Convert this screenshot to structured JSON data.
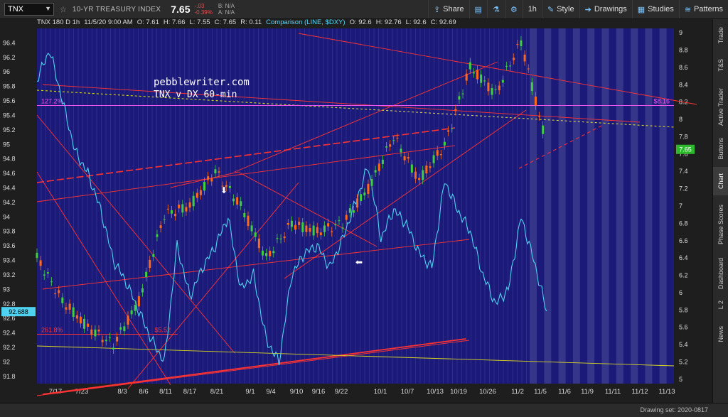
{
  "toolbar": {
    "symbol": "TNX",
    "index_name": "10-YR TREASURY INDEX",
    "last": "7.65",
    "change": "-.03",
    "change_pct": "-0.39%",
    "bid": "B: N/A",
    "ask": "A: N/A",
    "share_label": "Share",
    "interval_label": "1h",
    "style_label": "Style",
    "drawings_label": "Drawings",
    "studies_label": "Studies",
    "patterns_label": "Patterns"
  },
  "legend": {
    "main": "TNX 180 D 1h",
    "datetime": "11/5/20 9:00 AM",
    "o": "O: 7.61",
    "h": "H: 7.66",
    "l": "L: 7.55",
    "c": "C: 7.65",
    "r": "R: 0.11",
    "comparison": "Comparison (LINE, $DXY)",
    "co": "O: 92.6",
    "ch": "H: 92.76",
    "cl": "L: 92.6",
    "cc": "C: 92.69"
  },
  "right_panel": [
    "Trade",
    "T&S",
    "Active Trader",
    "Buttons",
    "Chart",
    "Phase Scores",
    "Dashboard",
    "L 2",
    "News"
  ],
  "bottom": {
    "drawing_set": "Drawing set: 2020-0817"
  },
  "colors": {
    "bg": "#1c1a78",
    "grid": "#5a5ac8",
    "future_band": "#35358a",
    "dxy": "#4fd2f0",
    "up": "#3fcf3f",
    "down": "#ff6a1a",
    "trend": "#ff3333",
    "fib": "#ee55ee",
    "yellow": "#d8d820"
  },
  "chart_data": {
    "type": "line",
    "annotations": [
      "pebblewriter.com",
      "TNX v DX 60-min"
    ],
    "left_axis_ticks": [
      96.4,
      96.2,
      96,
      95.8,
      95.6,
      95.4,
      95.2,
      95,
      94.8,
      94.6,
      94.4,
      94.2,
      94,
      93.8,
      93.6,
      93.4,
      93.2,
      93,
      92.8,
      92.6,
      92.4,
      92.2,
      92,
      91.8
    ],
    "right_axis_ticks": [
      9,
      8.8,
      8.6,
      8.4,
      8.2,
      8,
      7.8,
      7.6,
      7.4,
      7.2,
      7,
      6.8,
      6.6,
      6.4,
      6.2,
      6,
      5.8,
      5.6,
      5.4,
      5.2,
      5
    ],
    "x_ticks": [
      "7/17",
      "7/23",
      "8/3",
      "8/6",
      "8/11",
      "8/17",
      "8/21",
      "9/1",
      "9/4",
      "9/10",
      "9/16",
      "9/22",
      "10/1",
      "10/7",
      "10/13",
      "10/19",
      "10/26",
      "11/2",
      "11/5",
      "11/6",
      "11/9",
      "11/11",
      "11/12",
      "11/13"
    ],
    "left_ylim": [
      91.7,
      96.6
    ],
    "right_ylim": [
      4.95,
      9.05
    ],
    "left_price_tag": "92.688",
    "right_price_tag": "7.65",
    "fib_labels": [
      "127.2%",
      "$8.16",
      "261.8%",
      "$5.52"
    ],
    "fib_levels": [
      8.16,
      5.52
    ],
    "series": [
      {
        "name": "$DXY",
        "axis": "left",
        "x": [
          0,
          0.02,
          0.04,
          0.06,
          0.08,
          0.1,
          0.12,
          0.14,
          0.16,
          0.18,
          0.2,
          0.22,
          0.24,
          0.26,
          0.28,
          0.3,
          0.32,
          0.34,
          0.36,
          0.38,
          0.4,
          0.42,
          0.44,
          0.46,
          0.48,
          0.5,
          0.52,
          0.54,
          0.56,
          0.58,
          0.6,
          0.62,
          0.64,
          0.66,
          0.68,
          0.7,
          0.72,
          0.74,
          0.76,
          0.78,
          0.8
        ],
        "y": [
          95.9,
          96.3,
          95.6,
          94.9,
          94.6,
          94.1,
          93.4,
          93.1,
          92.7,
          92.3,
          92.0,
          93.6,
          92.9,
          93.3,
          93.6,
          94.0,
          93.0,
          93.2,
          92.3,
          92.0,
          93.2,
          93.5,
          93.6,
          93.3,
          93.7,
          94.2,
          94.7,
          93.7,
          94.1,
          93.9,
          93.5,
          93.3,
          94.5,
          94.1,
          93.8,
          93.2,
          92.8,
          93.0,
          94.0,
          93.4,
          92.7
        ]
      },
      {
        "name": "TNX",
        "axis": "right",
        "x": [
          0,
          0.04,
          0.08,
          0.12,
          0.16,
          0.2,
          0.24,
          0.28,
          0.32,
          0.36,
          0.4,
          0.44,
          0.48,
          0.52,
          0.56,
          0.6,
          0.64,
          0.68,
          0.72,
          0.76,
          0.8
        ],
        "y": [
          6.4,
          5.9,
          5.6,
          5.4,
          5.9,
          6.9,
          7.0,
          7.4,
          7.0,
          6.4,
          6.8,
          6.7,
          6.8,
          7.2,
          7.8,
          7.3,
          7.7,
          8.6,
          8.3,
          8.9,
          7.7
        ]
      }
    ]
  }
}
